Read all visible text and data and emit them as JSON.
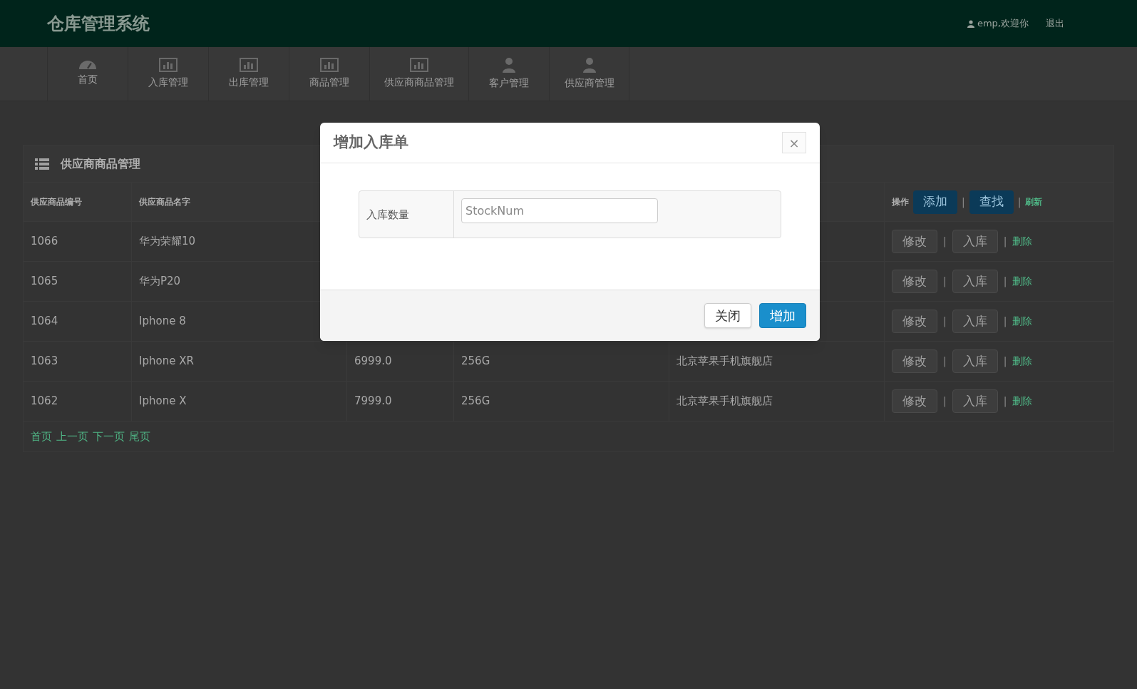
{
  "header": {
    "title": "仓库管理系统",
    "user": "emp,欢迎你",
    "logout": "退出"
  },
  "nav": [
    {
      "label": "首页",
      "kind": "gauge"
    },
    {
      "label": "入库管理",
      "kind": "chart"
    },
    {
      "label": "出库管理",
      "kind": "chart"
    },
    {
      "label": "商品管理",
      "kind": "chart"
    },
    {
      "label": "供应商商品管理",
      "kind": "chart"
    },
    {
      "label": "客户管理",
      "kind": "person"
    },
    {
      "label": "供应商管理",
      "kind": "person"
    }
  ],
  "panel": {
    "title": "供应商商品管理",
    "columns": [
      "供应商品编号",
      "供应商品名字"
    ],
    "actions_header": {
      "label": "操作",
      "add": "添加",
      "sep1": "|",
      "find": "查找",
      "sep2": "|",
      "refresh": "刷新"
    },
    "rows": [
      {
        "cells": [
          "1066",
          "华为荣耀10"
        ],
        "edit": "修改",
        "sep1": "|",
        "stock_in": "入库",
        "sep2": "|",
        "delete": "删除"
      },
      {
        "cells": [
          "1065",
          "华为P20"
        ],
        "edit": "修改",
        "sep1": "|",
        "stock_in": "入库",
        "sep2": "|",
        "delete": "删除"
      },
      {
        "cells": [
          "1064",
          "Iphone 8"
        ],
        "edit": "修改",
        "sep1": "|",
        "stock_in": "入库",
        "sep2": "|",
        "delete": "删除"
      },
      {
        "cells": [
          "1063",
          "Iphone XR",
          "6999.0",
          "256G",
          "北京苹果手机旗舰店"
        ],
        "edit": "修改",
        "sep1": "|",
        "stock_in": "入库",
        "sep2": "|",
        "delete": "删除"
      },
      {
        "cells": [
          "1062",
          "Iphone X",
          "7999.0",
          "256G",
          "北京苹果手机旗舰店"
        ],
        "edit": "修改",
        "sep1": "|",
        "stock_in": "入库",
        "sep2": "|",
        "delete": "删除"
      }
    ],
    "pagination": [
      "首页",
      "上一页",
      "下一页",
      "尾页"
    ]
  },
  "modal": {
    "title": "增加入库单",
    "close_glyph": "×",
    "field_label": "入库数量",
    "placeholder": "StockNum",
    "buttons": [
      {
        "label": "关闭",
        "kind": "default"
      },
      {
        "label": "增加",
        "kind": "primary"
      }
    ]
  }
}
